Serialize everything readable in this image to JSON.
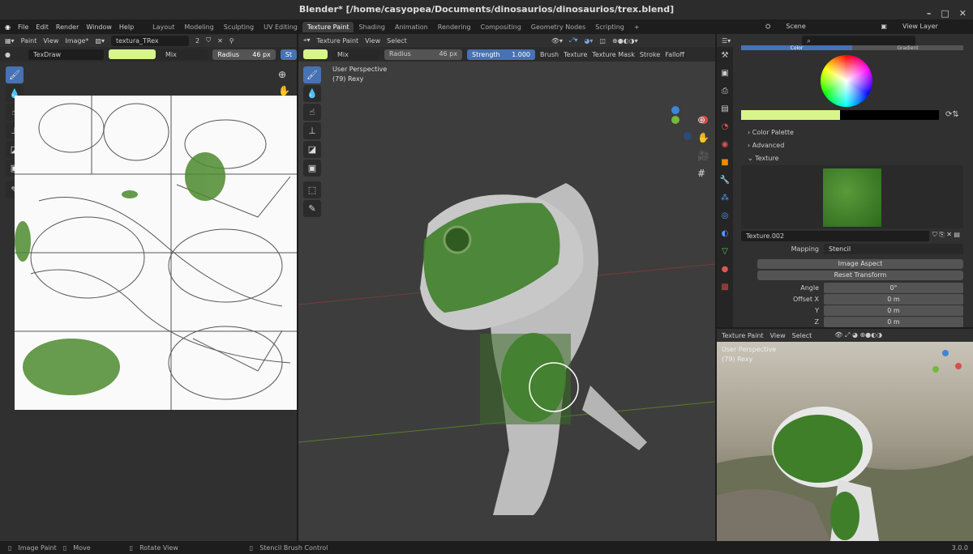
{
  "window": {
    "title": "Blender* [/home/casyopea/Documents/dinosaurios/dinosaurios/trex.blend]",
    "min": "–",
    "max": "□",
    "close": "✕"
  },
  "menu": [
    "File",
    "Edit",
    "Render",
    "Window",
    "Help"
  ],
  "workspaces": [
    "Layout",
    "Modeling",
    "Sculpting",
    "UV Editing",
    "Texture Paint",
    "Shading",
    "Animation",
    "Rendering",
    "Compositing",
    "Geometry Nodes",
    "Scripting",
    "+"
  ],
  "active_workspace": "Texture Paint",
  "scene": "Scene",
  "view_layer": "View Layer",
  "image_editor": {
    "mode": "Paint",
    "view": "View",
    "image_menu": "Image*",
    "image_name": "textura_TRex",
    "users": "2",
    "brush": "TexDraw",
    "blend": "Mix",
    "radius_label": "Radius",
    "radius": "46 px",
    "strength_short": "St"
  },
  "viewport": {
    "mode": "Texture Paint",
    "view": "View",
    "select": "Select",
    "blend": "Mix",
    "radius_label": "Radius",
    "radius": "46 px",
    "strength_label": "Strength",
    "strength": "1.000",
    "menus": [
      "Brush",
      "Texture",
      "Texture Mask",
      "Stroke",
      "Falloff"
    ],
    "perspective": "User Perspective",
    "object": "(79) Rexy"
  },
  "properties": {
    "tabs": [
      "Color",
      "Gradient"
    ],
    "color_hex": "#d8f58c",
    "panels": [
      "Color Palette",
      "Advanced",
      "Texture"
    ],
    "texture_name": "Texture.002",
    "mapping_label": "Mapping",
    "mapping": "Stencil",
    "image_aspect": "Image Aspect",
    "reset_transform": "Reset Transform",
    "angle_label": "Angle",
    "angle": "0°",
    "offset_x_label": "Offset X",
    "offset_x": "0 m",
    "y_label": "Y",
    "y": "0 m",
    "z_label": "Z",
    "z": "0 m"
  },
  "preview": {
    "mode": "Texture Paint",
    "view": "View",
    "select": "Select",
    "perspective": "User Perspective",
    "object": "(79) Rexy"
  },
  "status": {
    "items": [
      "Image Paint",
      "Move",
      "Rotate View",
      "Stencil Brush Control"
    ],
    "version": "3.0.0"
  }
}
